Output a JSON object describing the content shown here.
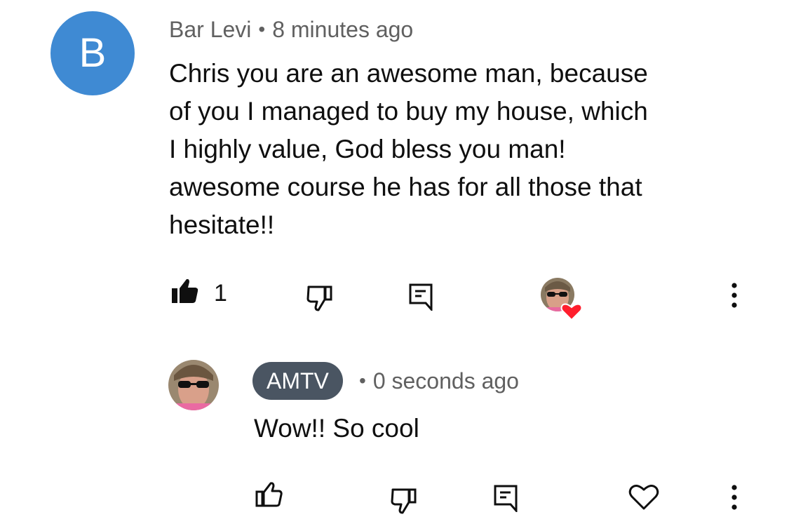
{
  "comment": {
    "avatar_letter": "B",
    "author": "Bar Levi",
    "separator": "•",
    "time": "8 minutes ago",
    "text_lines": [
      "Chris you are an awesome man, because",
      "of you I managed to buy my house, which",
      "I highly value, God bless you man!",
      "awesome course he has for all those that",
      "hesitate!!"
    ],
    "like_count": "1",
    "liked": true,
    "creator_hearted": true,
    "avatar_color": "#3f8ad3",
    "heart_color": "#ff0000"
  },
  "reply": {
    "author": "AMTV",
    "separator": "•",
    "time": "0 seconds ago",
    "text": "Wow!! So cool",
    "author_chip_color": "#4a5562"
  },
  "icons": {
    "like": "thumbs-up-icon",
    "dislike": "thumbs-down-icon",
    "reply": "comment-icon",
    "heart": "heart-icon",
    "more": "more-vertical-icon"
  }
}
